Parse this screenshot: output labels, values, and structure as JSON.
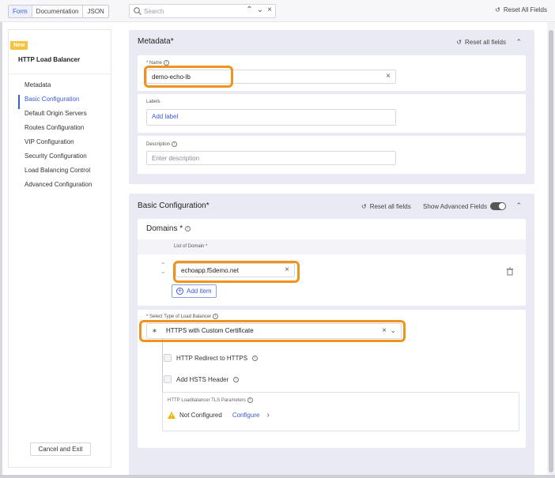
{
  "toolbar": {
    "tabs": [
      {
        "label": "Form",
        "active": true
      },
      {
        "label": "Documentation",
        "active": false
      },
      {
        "label": "JSON",
        "active": false
      }
    ],
    "search_placeholder": "Search",
    "reset_all": "Reset All Fields"
  },
  "sidebar": {
    "badge": "New",
    "title": "HTTP Load Balancer",
    "items": [
      {
        "label": "Metadata"
      },
      {
        "label": "Basic Configuration"
      },
      {
        "label": "Default Origin Servers"
      },
      {
        "label": "Routes Configuration"
      },
      {
        "label": "VIP Configuration"
      },
      {
        "label": "Security Configuration"
      },
      {
        "label": "Load Balancing Control"
      },
      {
        "label": "Advanced Configuration"
      }
    ],
    "cancel": "Cancel and Exit"
  },
  "metadata": {
    "title": "Metadata",
    "required_mark": "*",
    "reset": "Reset all fields",
    "name_label": "* Name",
    "name_value": "demo-echo-lb",
    "labels_label": "Labels",
    "labels_placeholder": "Add label",
    "desc_label": "Description",
    "desc_placeholder": "Enter description"
  },
  "basic": {
    "title": "Basic Configuration",
    "required_mark": "*",
    "reset": "Reset all fields",
    "advanced_toggle": "Show Advanced Fields",
    "domains_title": "Domains *",
    "list_label": "List of Domain *",
    "domain_value": "echoapp.f5demo.net",
    "add_item": "Add item",
    "lb_type_label": "* Select Type of Load Balancer",
    "lb_type_value": "HTTPS with Custom Certificate",
    "redirect_label": "HTTP Redirect to HTTPS",
    "hsts_label": "Add HSTS Header",
    "tls_label": "HTTP Loadbalancer TLS Parameters",
    "tls_status": "Not Configured",
    "tls_configure": "Configure"
  },
  "colors": {
    "accent": "#3b5bdb",
    "highlight": "#f0921e",
    "badge": "#f7c23d",
    "panel_bg": "#eaeaf4",
    "warning": "#f2b100"
  },
  "icons": [
    "search-icon",
    "chevron-up-icon",
    "chevron-down-icon",
    "close-icon",
    "reset-icon",
    "info-icon",
    "trash-icon",
    "add-circle-icon",
    "warning-icon",
    "chevron-right-icon",
    "load-balancer-icon"
  ]
}
